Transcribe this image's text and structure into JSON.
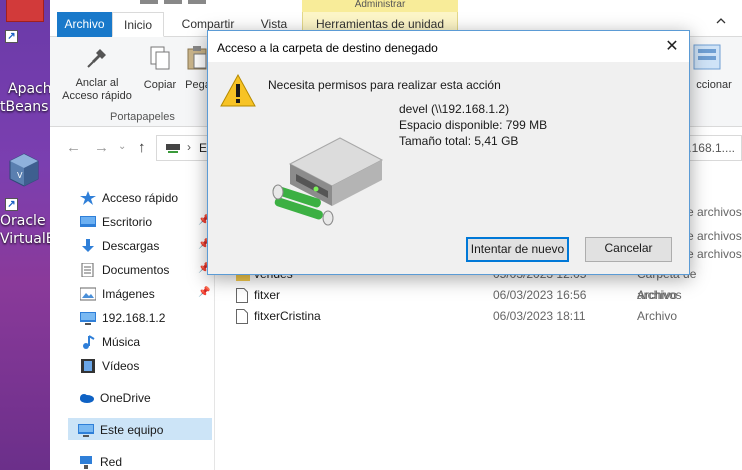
{
  "desktop": {
    "netbeans_line1": "Apach",
    "netbeans_line2": "tBeans",
    "oracle_line1": "Oracle",
    "oracle_line2": "VirtualB"
  },
  "ribbon": {
    "tabs": [
      "Archivo",
      "Inicio",
      "Compartir",
      "Vista",
      "Herramientas de unidad"
    ],
    "manage_label": "Administrar",
    "buttons": {
      "anclar": "Anclar al Acceso rápido",
      "copiar": "Copiar",
      "pegar": "Pega",
      "seleccionar": "ccionar"
    },
    "group_label": "Portapapeles"
  },
  "address": {
    "partial": "E",
    "right_partial": "/192.168.1...."
  },
  "nav_pane": {
    "items": [
      {
        "label": "Acceso rápido",
        "icon": "star-icon"
      },
      {
        "label": "Escritorio",
        "icon": "desktop-icon"
      },
      {
        "label": "Descargas",
        "icon": "download-icon"
      },
      {
        "label": "Documentos",
        "icon": "documents-icon"
      },
      {
        "label": "Imágenes",
        "icon": "pictures-icon"
      },
      {
        "label": "192.168.1.2",
        "icon": "network-drive-icon"
      },
      {
        "label": "Música",
        "icon": "music-icon"
      },
      {
        "label": "Vídeos",
        "icon": "video-icon"
      },
      {
        "label": "OneDrive",
        "icon": "cloud-icon"
      },
      {
        "label": "Este equipo",
        "icon": "computer-icon"
      },
      {
        "label": "Red",
        "icon": "network-icon"
      }
    ]
  },
  "files": {
    "right_types": [
      "e archivos",
      "e archivos",
      "e archivos"
    ],
    "rows": [
      {
        "name": "vendes",
        "date": "05/03/2023 12:05",
        "type": "Carpeta de archivos"
      },
      {
        "name": "fitxer",
        "date": "06/03/2023 16:56",
        "type": "Archivo"
      },
      {
        "name": "fitxerCristina",
        "date": "06/03/2023 18:11",
        "type": "Archivo"
      }
    ]
  },
  "dialog": {
    "title": "Acceso a la carpeta de destino denegado",
    "message": "Necesita permisos para realizar esta acción",
    "drive_name": "devel (\\\\192.168.1.2)",
    "free_space": "Espacio disponible: 799 MB",
    "total_size": "Tamaño total: 5,41 GB",
    "retry_label": "Intentar de nuevo",
    "cancel_label": "Cancelar"
  },
  "colors": {
    "accent": "#1979ca",
    "selection": "#cce4f7",
    "dialog_border": "#5b9bd5",
    "default_button_border": "#0078d7"
  }
}
